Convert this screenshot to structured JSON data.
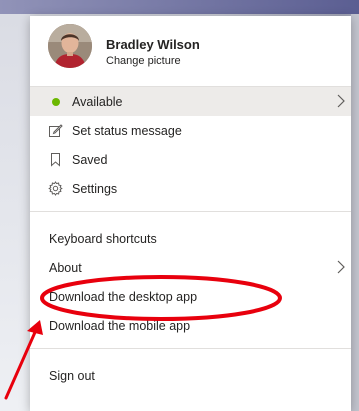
{
  "profile": {
    "name": "Bradley Wilson",
    "change_picture": "Change picture"
  },
  "status": {
    "label": "Available",
    "color": "#6bb700"
  },
  "menu": {
    "set_status": "Set status message",
    "saved": "Saved",
    "settings": "Settings",
    "keyboard_shortcuts": "Keyboard shortcuts",
    "about": "About",
    "download_desktop": "Download the desktop app",
    "download_mobile": "Download the mobile app",
    "sign_out": "Sign out"
  },
  "annotation": {
    "highlight_color": "#e8000d",
    "highlighted_item": "Download the desktop app"
  }
}
